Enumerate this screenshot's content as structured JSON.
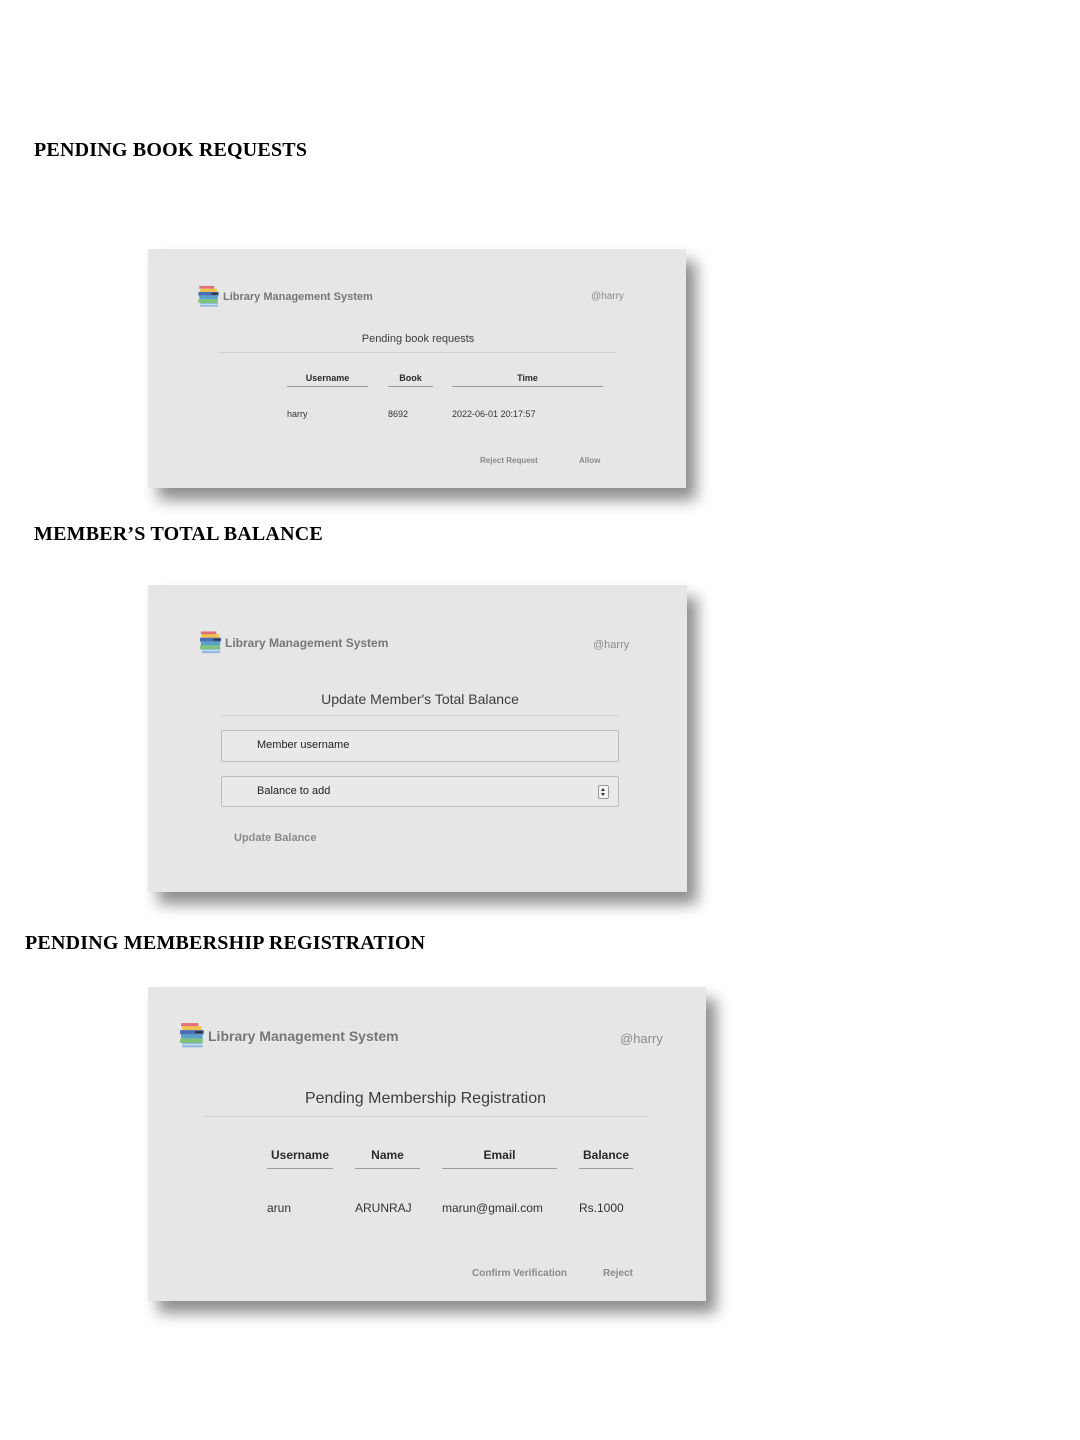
{
  "sections": {
    "book_requests": {
      "heading": "PENDING BOOK REQUESTS",
      "app_title": "Library Management System",
      "user": "@harry",
      "page_title": "Pending book requests",
      "columns": [
        "Username",
        "Book",
        "Time"
      ],
      "row": [
        "harry",
        "8692",
        "2022-06-01 20:17:57"
      ],
      "reject_label": "Reject Request",
      "allow_label": "Allow"
    },
    "balance": {
      "heading": "MEMBER’S TOTAL BALANCE",
      "app_title": "Library Management System",
      "user": "@harry",
      "page_title": "Update Member's Total Balance",
      "username_placeholder": "Member username",
      "balance_placeholder": "Balance to add",
      "update_label": "Update Balance"
    },
    "registration": {
      "heading": "PENDING MEMBERSHIP REGISTRATION",
      "app_title": "Library Management System",
      "user": "@harry",
      "page_title": "Pending Membership Registration",
      "columns": [
        "Username",
        "Name",
        "Email",
        "Balance"
      ],
      "row": [
        "arun",
        "ARUNRAJ",
        "marun@gmail.com",
        "Rs.1000"
      ],
      "confirm_label": "Confirm Verification",
      "reject_label": "Reject"
    }
  },
  "icons": {
    "logo": "books-stack-icon",
    "spinner": "spinner-arrows-icon"
  }
}
